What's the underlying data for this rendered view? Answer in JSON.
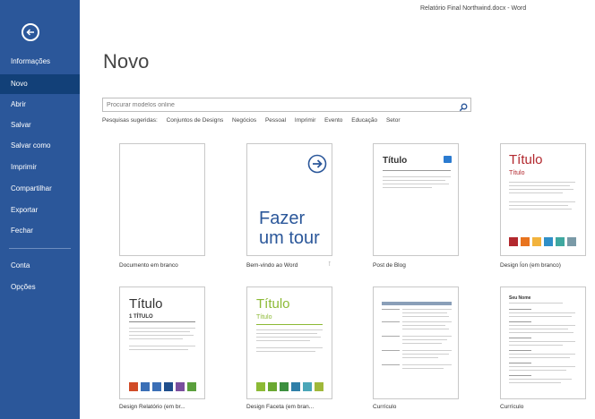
{
  "window": {
    "title": "Relatório Final Northwind.docx - Word"
  },
  "sidebar": {
    "items": [
      {
        "label": "Informações"
      },
      {
        "label": "Novo"
      },
      {
        "label": "Abrir"
      },
      {
        "label": "Salvar"
      },
      {
        "label": "Salvar como"
      },
      {
        "label": "Imprimir"
      },
      {
        "label": "Compartilhar"
      },
      {
        "label": "Exportar"
      },
      {
        "label": "Fechar"
      },
      {
        "label": "Conta"
      },
      {
        "label": "Opções"
      }
    ],
    "active": "Novo"
  },
  "main": {
    "title": "Novo",
    "search": {
      "placeholder": "Procurar modelos online"
    },
    "suggested": {
      "label": "Pesquisas sugeridas:",
      "links": [
        "Conjuntos de Designs",
        "Negócios",
        "Pessoal",
        "Imprimir",
        "Evento",
        "Educação",
        "Setor"
      ]
    },
    "templates": [
      {
        "label": "Documento em branco"
      },
      {
        "label": "Bem-vindo ao Word",
        "text_line1": "Fazer",
        "text_line2": "um tour"
      },
      {
        "label": "Post de Blog",
        "heading": "Título"
      },
      {
        "label": "Design Íon (em branco)",
        "heading": "Título",
        "subheading": "Título"
      },
      {
        "label": "Design Relatório (em br...",
        "heading": "Título",
        "subheading": "1 TÍTULO"
      },
      {
        "label": "Design Faceta (em bran...",
        "heading": "Título",
        "subheading": "Título"
      },
      {
        "label": "Currículo"
      },
      {
        "label": "Currículo",
        "name": "Seu Nome"
      }
    ]
  },
  "colors": {
    "sidebar_bg": "#2b579a",
    "sidebar_active": "#124078",
    "ion_red": "#b2282e",
    "facet_green": "#8cba35"
  },
  "icons": [
    "back-arrow-icon",
    "search-icon",
    "tour-arrow-icon",
    "pin-icon",
    "blog-icon"
  ]
}
